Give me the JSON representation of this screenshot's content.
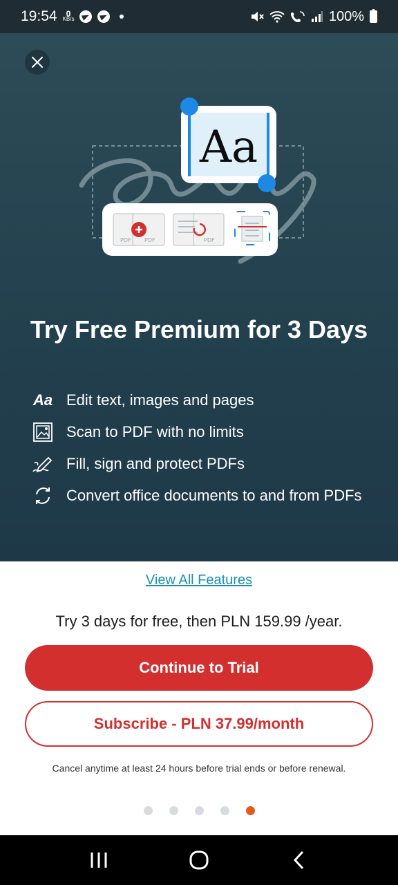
{
  "status_bar": {
    "time": "19:54",
    "speed_value": "0",
    "speed_unit": "KB/s",
    "battery": "100%",
    "icons": [
      "telegram-icon",
      "telegram-icon",
      "dot-icon",
      "mute-icon",
      "wifi-icon",
      "wifi-call-icon",
      "signal-icon",
      "battery-icon"
    ]
  },
  "hero": {
    "title": "Try Free Premium for 3 Days",
    "illustration_text": "Aa",
    "illustration_doc_labels": [
      "PDF",
      "PDF",
      "PDF"
    ],
    "features": [
      {
        "icon": "aa-text-icon",
        "icon_text": "Aa",
        "label": "Edit text, images and pages"
      },
      {
        "icon": "scan-icon",
        "label": "Scan to PDF with no limits"
      },
      {
        "icon": "sign-icon",
        "label": "Fill, sign and protect PDFs"
      },
      {
        "icon": "convert-icon",
        "label": "Convert office documents to and from PDFs"
      }
    ]
  },
  "offer": {
    "view_all": "View All Features",
    "price_text": "Try 3 days for free, then PLN 159.99 /year.",
    "trial_button": "Continue to Trial",
    "subscribe_button": "Subscribe - PLN 37.99/month",
    "cancel_note": "Cancel anytime at least 24 hours before trial ends or before renewal."
  },
  "pager": {
    "count": 5,
    "active_index": 4
  },
  "colors": {
    "accent_red": "#d32f2f",
    "link_blue": "#1a8fb4",
    "hero_bg": "#254350",
    "pager_active": "#e25a1c"
  }
}
